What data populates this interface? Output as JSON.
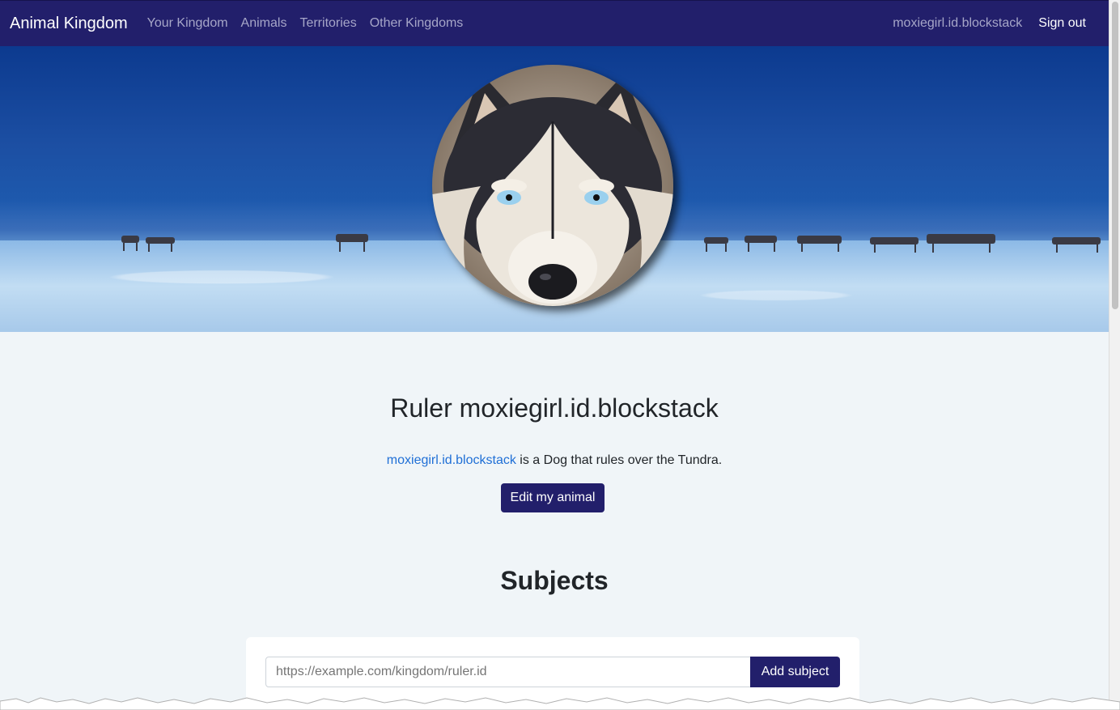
{
  "navbar": {
    "brand": "Animal Kingdom",
    "links": [
      "Your Kingdom",
      "Animals",
      "Territories",
      "Other Kingdoms"
    ],
    "user": "moxiegirl.id.blockstack",
    "signout": "Sign out"
  },
  "hero": {
    "avatar_icon": "husky-dog-avatar"
  },
  "ruler": {
    "title": "Ruler moxiegirl.id.blockstack",
    "user_link": "moxiegirl.id.blockstack",
    "description": " is a Dog that rules over the Tundra.",
    "edit_button": "Edit my animal"
  },
  "subjects": {
    "title": "Subjects",
    "input_placeholder": "https://example.com/kingdom/ruler.id",
    "add_button": "Add subject"
  },
  "colors": {
    "navbar": "#221f6b",
    "link": "#1f6fd6",
    "page_bg": "#f0f5f8"
  }
}
